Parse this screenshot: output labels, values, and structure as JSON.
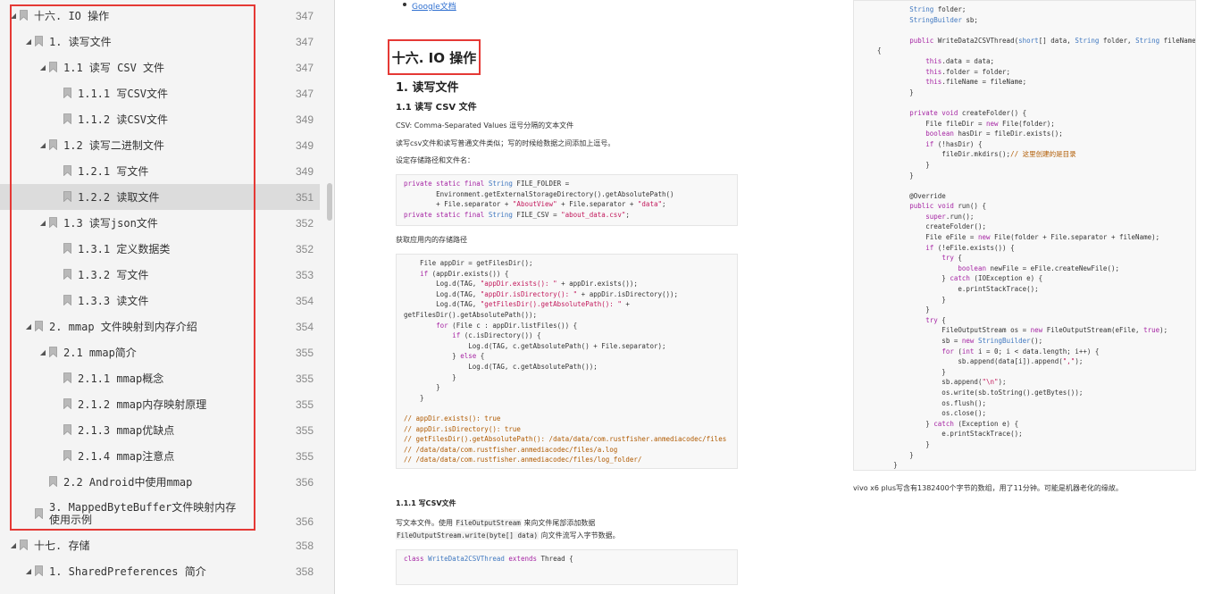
{
  "toc": {
    "items": [
      {
        "label": "十六. IO 操作",
        "page": "347",
        "level": 0,
        "expanded": true,
        "active": false
      },
      {
        "label": "1. 读写文件",
        "page": "347",
        "level": 1,
        "expanded": true,
        "active": false
      },
      {
        "label": "1.1 读写 CSV 文件",
        "page": "347",
        "level": 2,
        "expanded": true,
        "active": false
      },
      {
        "label": "1.1.1 写CSV文件",
        "page": "347",
        "level": 3,
        "expanded": false,
        "active": false
      },
      {
        "label": "1.1.2 读CSV文件",
        "page": "349",
        "level": 3,
        "expanded": false,
        "active": false
      },
      {
        "label": "1.2 读写二进制文件",
        "page": "349",
        "level": 2,
        "expanded": true,
        "active": false
      },
      {
        "label": "1.2.1 写文件",
        "page": "349",
        "level": 3,
        "expanded": false,
        "active": false
      },
      {
        "label": "1.2.2 读取文件",
        "page": "351",
        "level": 3,
        "expanded": false,
        "active": true
      },
      {
        "label": "1.3 读写json文件",
        "page": "352",
        "level": 2,
        "expanded": true,
        "active": false
      },
      {
        "label": "1.3.1 定义数据类",
        "page": "352",
        "level": 3,
        "expanded": false,
        "active": false
      },
      {
        "label": "1.3.2 写文件",
        "page": "353",
        "level": 3,
        "expanded": false,
        "active": false
      },
      {
        "label": "1.3.3 读文件",
        "page": "354",
        "level": 3,
        "expanded": false,
        "active": false
      },
      {
        "label": "2. mmap 文件映射到内存介绍",
        "page": "354",
        "level": 1,
        "expanded": true,
        "active": false
      },
      {
        "label": "2.1 mmap简介",
        "page": "355",
        "level": 2,
        "expanded": true,
        "active": false
      },
      {
        "label": "2.1.1 mmap概念",
        "page": "355",
        "level": 3,
        "expanded": false,
        "active": false
      },
      {
        "label": "2.1.2 mmap内存映射原理",
        "page": "355",
        "level": 3,
        "expanded": false,
        "active": false
      },
      {
        "label": "2.1.3 mmap优缺点",
        "page": "355",
        "level": 3,
        "expanded": false,
        "active": false
      },
      {
        "label": "2.1.4 mmap注意点",
        "page": "355",
        "level": 3,
        "expanded": false,
        "active": false
      },
      {
        "label": "2.2 Android中使用mmap",
        "page": "356",
        "level": 2,
        "expanded": false,
        "active": false
      },
      {
        "label": "3. MappedByteBuffer文件映射内存使用示例",
        "page": "356",
        "level": 1,
        "expanded": false,
        "active": false
      },
      {
        "label": "十七. 存储",
        "page": "358",
        "level": 0,
        "expanded": true,
        "active": false
      },
      {
        "label": "1. SharedPreferences 简介",
        "page": "358",
        "level": 1,
        "expanded": true,
        "active": false
      }
    ]
  },
  "mid": {
    "link": "Google文档",
    "chapter": "十六. IO 操作",
    "section": "1. 读写文件",
    "subsection": "1.1 读写 CSV 文件",
    "p1": "CSV: Comma-Separated Values 逗号分隔的文本文件",
    "p2": "读写csv文件和读写普通文件类似；写的时候给数据之间添加上逗号。",
    "p3": "设定存储路径和文件名：",
    "p4": "获取应用内的存储路径",
    "h111": "1.1.1 写CSV文件",
    "p5a": "写文本文件。使用 ",
    "p5code": "FileOutputStream",
    "p5b": " 来向文件尾部添加数据",
    "p6code": "FileOutputStream.write(byte[] data)",
    "p6b": " 向文件流写入字节数据。",
    "code4": "class WriteData2CSVThread extends Thread {"
  },
  "right": {
    "note": "vivo x6 plus写含有1382400个字节的数组，用了11分钟。可能是机器老化的缘故。"
  },
  "colors": {
    "highlight_box": "#e53935",
    "link": "#2e6fd0",
    "sidebar_bg": "#f4f4f4",
    "active_row": "#dcdcdc"
  },
  "icons": {
    "expand": "triangle-down-icon",
    "bookmark": "bookmark-icon"
  }
}
